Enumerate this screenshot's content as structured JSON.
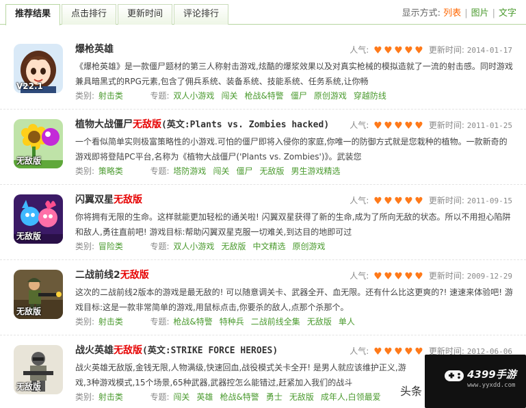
{
  "tabs": [
    {
      "label": "推荐结果",
      "active": true
    },
    {
      "label": "点击排行",
      "active": false
    },
    {
      "label": "更新时间",
      "active": false
    },
    {
      "label": "评论排行",
      "active": false
    }
  ],
  "display_mode": {
    "label": "显示方式:",
    "options": [
      {
        "label": "列表",
        "active": true
      },
      {
        "label": "图片",
        "active": false
      },
      {
        "label": "文字",
        "active": false
      }
    ]
  },
  "labels": {
    "popularity": "人气:",
    "updated": "更新时间:",
    "category": "类别:",
    "topic": "专题:"
  },
  "items": [
    {
      "title": "爆枪英雄",
      "title_highlight": "",
      "title_sub": "",
      "thumb_tag": "V22.1",
      "hearts": 5,
      "date": "2014-01-17",
      "description": "《爆枪英雄》是一款僵尸题材的第三人称射击游戏,炫酷的爆浆效果以及对真实枪械的模拟造就了一流的射击感。同时游戏兼具暗黑式的RPG元素,包含了佣兵系统、装备系统、技能系统、任务系统,让你畅",
      "category": "射击类",
      "topics": [
        "双人小游戏",
        "闯关",
        "枪战&特警",
        "僵尸",
        "原创游戏",
        "穿越防线"
      ]
    },
    {
      "title": "植物大战僵尸",
      "title_highlight": "无敌版",
      "title_sub": "(英文:Plants vs. Zombies hacked)",
      "thumb_tag": "无敌版",
      "hearts": 5,
      "date": "2011-01-25",
      "description": "一个看似简单实则极富策略性的小游戏.可怕的僵尸即将入侵你的家庭,你唯一的防御方式就是您栽种的植物。一款新奇的游戏即将登陆PC平台,名称为《植物大战僵尸('Plants vs. Zombies')》。武装您",
      "category": "策略类",
      "topics": [
        "塔防游戏",
        "闯关",
        "僵尸",
        "无敌版",
        "男生游戏精选"
      ]
    },
    {
      "title": "闪翼双星",
      "title_highlight": "无敌版",
      "title_sub": "",
      "thumb_tag": "无敌版",
      "hearts": 5,
      "date": "2011-09-15",
      "description": "你将拥有无限的生命。这样就能更加轻松的通关啦! 闪翼双星获得了新的生命,成为了所向无敌的状态。所以不用担心陷阱和敌人,勇往直前吧! 游戏目标:帮助闪翼双星克服一切难关,到达目的地即可过",
      "category": "冒险类",
      "topics": [
        "双人小游戏",
        "无敌版",
        "中文精选",
        "原创游戏"
      ]
    },
    {
      "title": "二战前线2",
      "title_highlight": "无敌版",
      "title_sub": "",
      "thumb_tag": "无敌版",
      "hearts": 5,
      "date": "2009-12-29",
      "description": "这次的二战前线2版本的游戏是最无敌的! 可以随意调关卡、武器全开、血无限。还有什么比这更爽的?! 速速来体验吧! 游戏目标:这是一款非常简单的游戏,用鼠标点击,你要杀的敌人,点那个杀那个。",
      "category": "射击类",
      "topics": [
        "枪战&特警",
        "特种兵",
        "二战前线全集",
        "无敌版",
        "单人"
      ]
    },
    {
      "title": "战火英雄",
      "title_highlight": "无敌版",
      "title_sub": "(英文:STRIKE FORCE HEROES)",
      "thumb_tag": "无敌版",
      "hearts": 5,
      "date": "2012-06-06",
      "description": "战火英雄无敌版,金钱无限,人物满级,快速回血,战役模式关卡全开! 是男人就应该维护正义,游戏,3种游戏模式,15个场景,65种武器,武器控怎么能错过,赶紧加入我们的战斗",
      "category": "射击类",
      "topics": [
        "闯关",
        "英雄",
        "枪战&特警",
        "勇士",
        "无敌版",
        "成年人,白领最爱"
      ]
    }
  ],
  "watermark": {
    "brand": "4399手游",
    "url": "www.yyxdd.com",
    "source": "头条"
  },
  "colors": {
    "accent_green": "#4a9a2e",
    "highlight_red": "#e60000",
    "heart_orange": "#ff7a1a",
    "active_orange": "#ff6600"
  }
}
